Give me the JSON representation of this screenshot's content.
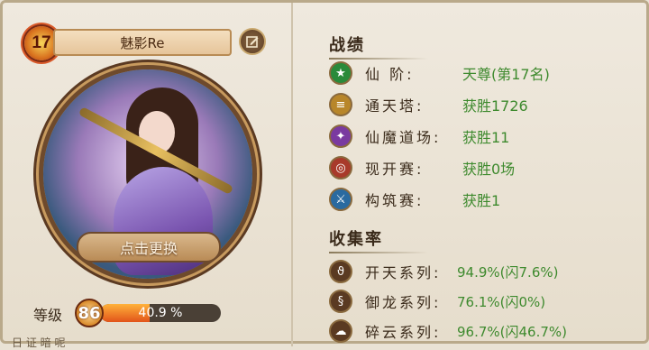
{
  "player": {
    "level": "17",
    "name": "魅影Re",
    "change_label": "点击更换",
    "grade_label": "等级",
    "grade_value": "86",
    "exp_percent": 40.9,
    "exp_text": "40.9 %",
    "bottom_text": "日 证 暗 呢"
  },
  "record": {
    "title": "战绩",
    "rows": [
      {
        "icon": "star-icon",
        "label": "仙 阶:",
        "value": "天尊(第17名)",
        "color": "#2a8a3a"
      },
      {
        "icon": "tower-icon",
        "label": "通天塔:",
        "value": "获胜1726",
        "color": "#b8862a"
      },
      {
        "icon": "bird-icon",
        "label": "仙魔道场:",
        "value": "获胜11",
        "color": "#7a3aa0"
      },
      {
        "icon": "swirl-icon",
        "label": "现开赛:",
        "value": "获胜0场",
        "color": "#a83a2a"
      },
      {
        "icon": "sword-icon",
        "label": "构筑赛:",
        "value": "获胜1",
        "color": "#2a6aa0"
      }
    ]
  },
  "collection": {
    "title": "收集率",
    "rows": [
      {
        "icon": "kaitian-icon",
        "label": "开天系列:",
        "value": "94.9%(闪7.6%)"
      },
      {
        "icon": "yulong-icon",
        "label": "御龙系列:",
        "value": "76.1%(闪0%)"
      },
      {
        "icon": "suiyun-icon",
        "label": "碎云系列:",
        "value": "96.7%(闪46.7%)"
      }
    ]
  }
}
